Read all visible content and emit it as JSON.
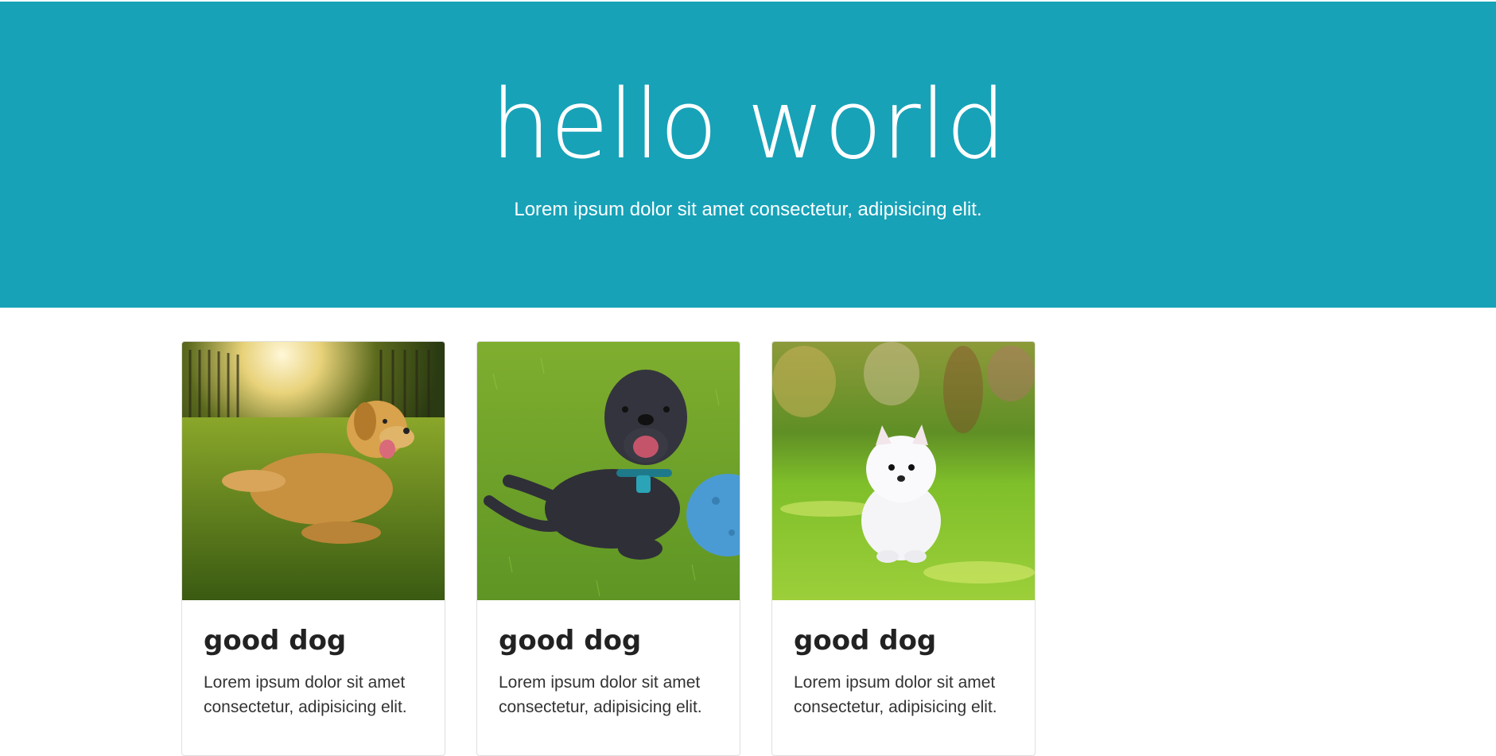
{
  "hero": {
    "title": "hello world",
    "subtitle": "Lorem ipsum dolor sit amet consectetur, adipisicing elit.",
    "background_color": "#17a2b8"
  },
  "cards": [
    {
      "image_icon": "golden-retriever-photo",
      "title": "good dog",
      "text": "Lorem ipsum dolor sit amet consectetur, adipisicing elit."
    },
    {
      "image_icon": "black-dog-with-ball-photo",
      "title": "good dog",
      "text": "Lorem ipsum dolor sit amet consectetur, adipisicing elit."
    },
    {
      "image_icon": "white-pomeranian-puppy-photo",
      "title": "good dog",
      "text": "Lorem ipsum dolor sit amet consectetur, adipisicing elit."
    }
  ]
}
